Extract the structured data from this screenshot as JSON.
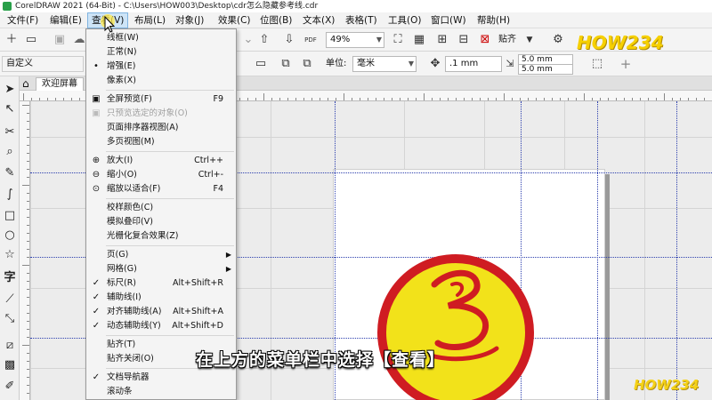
{
  "window": {
    "title": "CorelDRAW 2021 (64-Bit) - C:\\Users\\HOW003\\Desktop\\cdr怎么隐藏参考线.cdr"
  },
  "menubar": {
    "items": [
      "文件(F)",
      "编辑(E)",
      "查看(V)",
      "布局(L)",
      "对象(J)",
      "效果(C)",
      "位图(B)",
      "文本(X)",
      "表格(T)",
      "工具(O)",
      "窗口(W)",
      "帮助(H)"
    ],
    "active": "查看(V)"
  },
  "toolbar1": {
    "zoom_value": "49%",
    "snap_label": "贴齐"
  },
  "toolbar2": {
    "preset_value": "自定义",
    "units_label": "单位:",
    "units_value": "毫米",
    "nudge_value": ".1 mm",
    "dup_x": "5.0 mm",
    "dup_y": "5.0 mm",
    "add_icon": "+"
  },
  "tabs": {
    "welcome_label": "欢迎屏幕"
  },
  "view_menu": {
    "items": [
      {
        "label": "线框(W)",
        "check": "",
        "accel": "",
        "submenu": false,
        "disabled": false
      },
      {
        "label": "正常(N)",
        "check": "",
        "accel": "",
        "submenu": false,
        "disabled": false
      },
      {
        "label": "增强(E)",
        "check": "•",
        "accel": "",
        "submenu": false,
        "disabled": false
      },
      {
        "label": "像素(X)",
        "check": "",
        "accel": "",
        "submenu": false,
        "disabled": false
      },
      {
        "sep": true
      },
      {
        "label": "全屏预览(F)",
        "check": "",
        "icon": "fullscreen-icon",
        "accel": "F9",
        "submenu": false,
        "disabled": false
      },
      {
        "label": "只预览选定的对象(O)",
        "check": "",
        "icon": "preview-selected-icon",
        "accel": "",
        "submenu": false,
        "disabled": true
      },
      {
        "label": "页面排序器视图(A)",
        "check": "",
        "accel": "",
        "submenu": false,
        "disabled": false
      },
      {
        "label": "多页视图(M)",
        "check": "",
        "accel": "",
        "submenu": false,
        "disabled": false
      },
      {
        "sep": true
      },
      {
        "label": "放大(I)",
        "check": "",
        "icon": "zoom-in-icon",
        "accel": "Ctrl++",
        "submenu": false,
        "disabled": false
      },
      {
        "label": "缩小(O)",
        "check": "",
        "icon": "zoom-out-icon",
        "accel": "Ctrl+-",
        "submenu": false,
        "disabled": false
      },
      {
        "label": "缩放以适合(F)",
        "check": "",
        "icon": "zoom-fit-icon",
        "accel": "F4",
        "submenu": false,
        "disabled": false
      },
      {
        "sep": true
      },
      {
        "label": "校样颜色(C)",
        "check": "",
        "accel": "",
        "submenu": false,
        "disabled": false
      },
      {
        "label": "模拟叠印(V)",
        "check": "",
        "accel": "",
        "submenu": false,
        "disabled": false
      },
      {
        "label": "光栅化复合效果(Z)",
        "check": "",
        "accel": "",
        "submenu": false,
        "disabled": false
      },
      {
        "sep": true
      },
      {
        "label": "页(G)",
        "check": "",
        "accel": "",
        "submenu": true,
        "disabled": false
      },
      {
        "label": "网格(G)",
        "check": "",
        "accel": "",
        "submenu": true,
        "disabled": false
      },
      {
        "label": "标尺(R)",
        "check": "✓",
        "accel": "Alt+Shift+R",
        "submenu": false,
        "disabled": false
      },
      {
        "label": "辅助线(I)",
        "check": "✓",
        "accel": "",
        "submenu": false,
        "disabled": false
      },
      {
        "label": "对齐辅助线(A)",
        "check": "✓",
        "accel": "Alt+Shift+A",
        "submenu": false,
        "disabled": false
      },
      {
        "label": "动态辅助线(Y)",
        "check": "✓",
        "accel": "Alt+Shift+D",
        "submenu": false,
        "disabled": false
      },
      {
        "sep": true
      },
      {
        "label": "贴齐(T)",
        "check": "",
        "accel": "",
        "submenu": false,
        "disabled": false
      },
      {
        "label": "贴齐关闭(O)",
        "check": "",
        "accel": "",
        "submenu": false,
        "disabled": false
      },
      {
        "sep": true
      },
      {
        "label": "文档导航器",
        "check": "✓",
        "accel": "",
        "submenu": false,
        "disabled": false
      },
      {
        "label": "滚动条",
        "check": "",
        "accel": "",
        "submenu": false,
        "disabled": false
      }
    ]
  },
  "subtitle": "在上方的菜单栏中选择【查看】",
  "watermark": {
    "top": "HOW234",
    "bottom": "HOW234"
  },
  "colors": {
    "logo_yellow": "#f2e21a",
    "logo_red": "#cf1c22",
    "guide_blue": "#2c3fae",
    "menu_highlight": "#cde4f7"
  }
}
